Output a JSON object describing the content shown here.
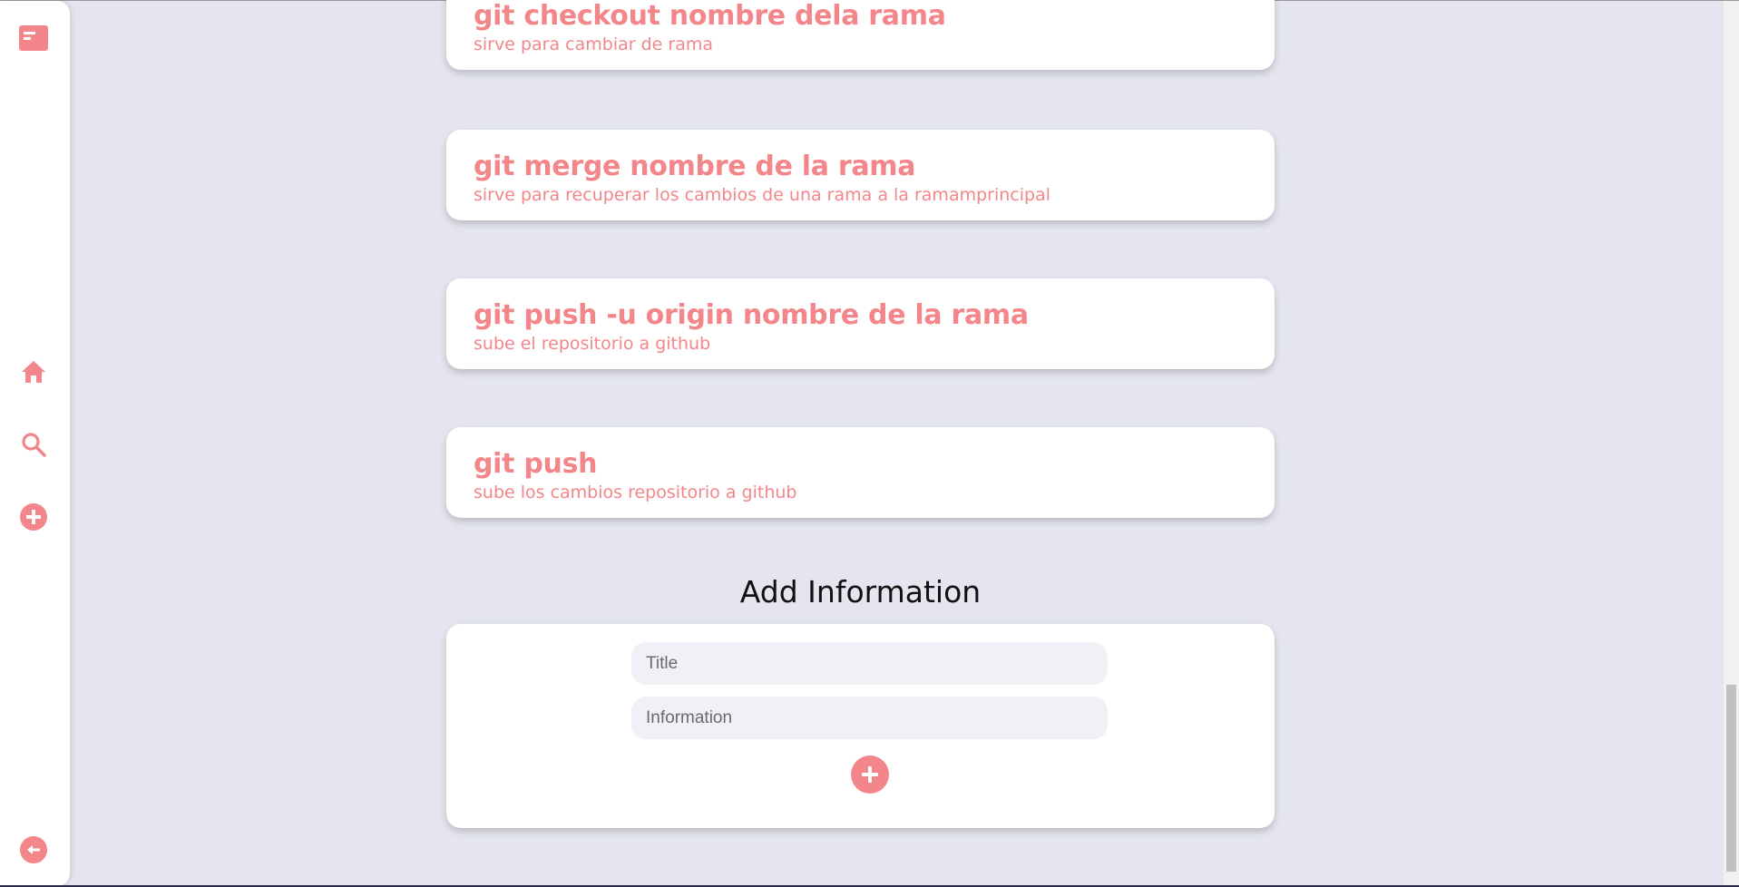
{
  "sidebar": {
    "items": [
      {
        "name": "cards-icon"
      },
      {
        "name": "home-icon"
      },
      {
        "name": "search-icon"
      },
      {
        "name": "add-icon"
      },
      {
        "name": "back-icon"
      }
    ],
    "accent": "#f3868a"
  },
  "cards": [
    {
      "title": "git checkout nombre dela rama",
      "info": "sirve para cambiar de rama"
    },
    {
      "title": "git merge nombre de la rama",
      "info": "sirve para recuperar los cambios de una rama a la ramamprincipal"
    },
    {
      "title": "git push -u origin nombre de la rama",
      "info": "sube el repositorio a github"
    },
    {
      "title": "git push",
      "info": "sube los cambios repositorio a github"
    }
  ],
  "form": {
    "heading": "Add Information",
    "title_placeholder": "Title",
    "info_placeholder": "Information",
    "title_value": "",
    "info_value": ""
  },
  "colors": {
    "background": "#e4e5ee",
    "card": "#ffffff",
    "accent": "#f3868a"
  }
}
